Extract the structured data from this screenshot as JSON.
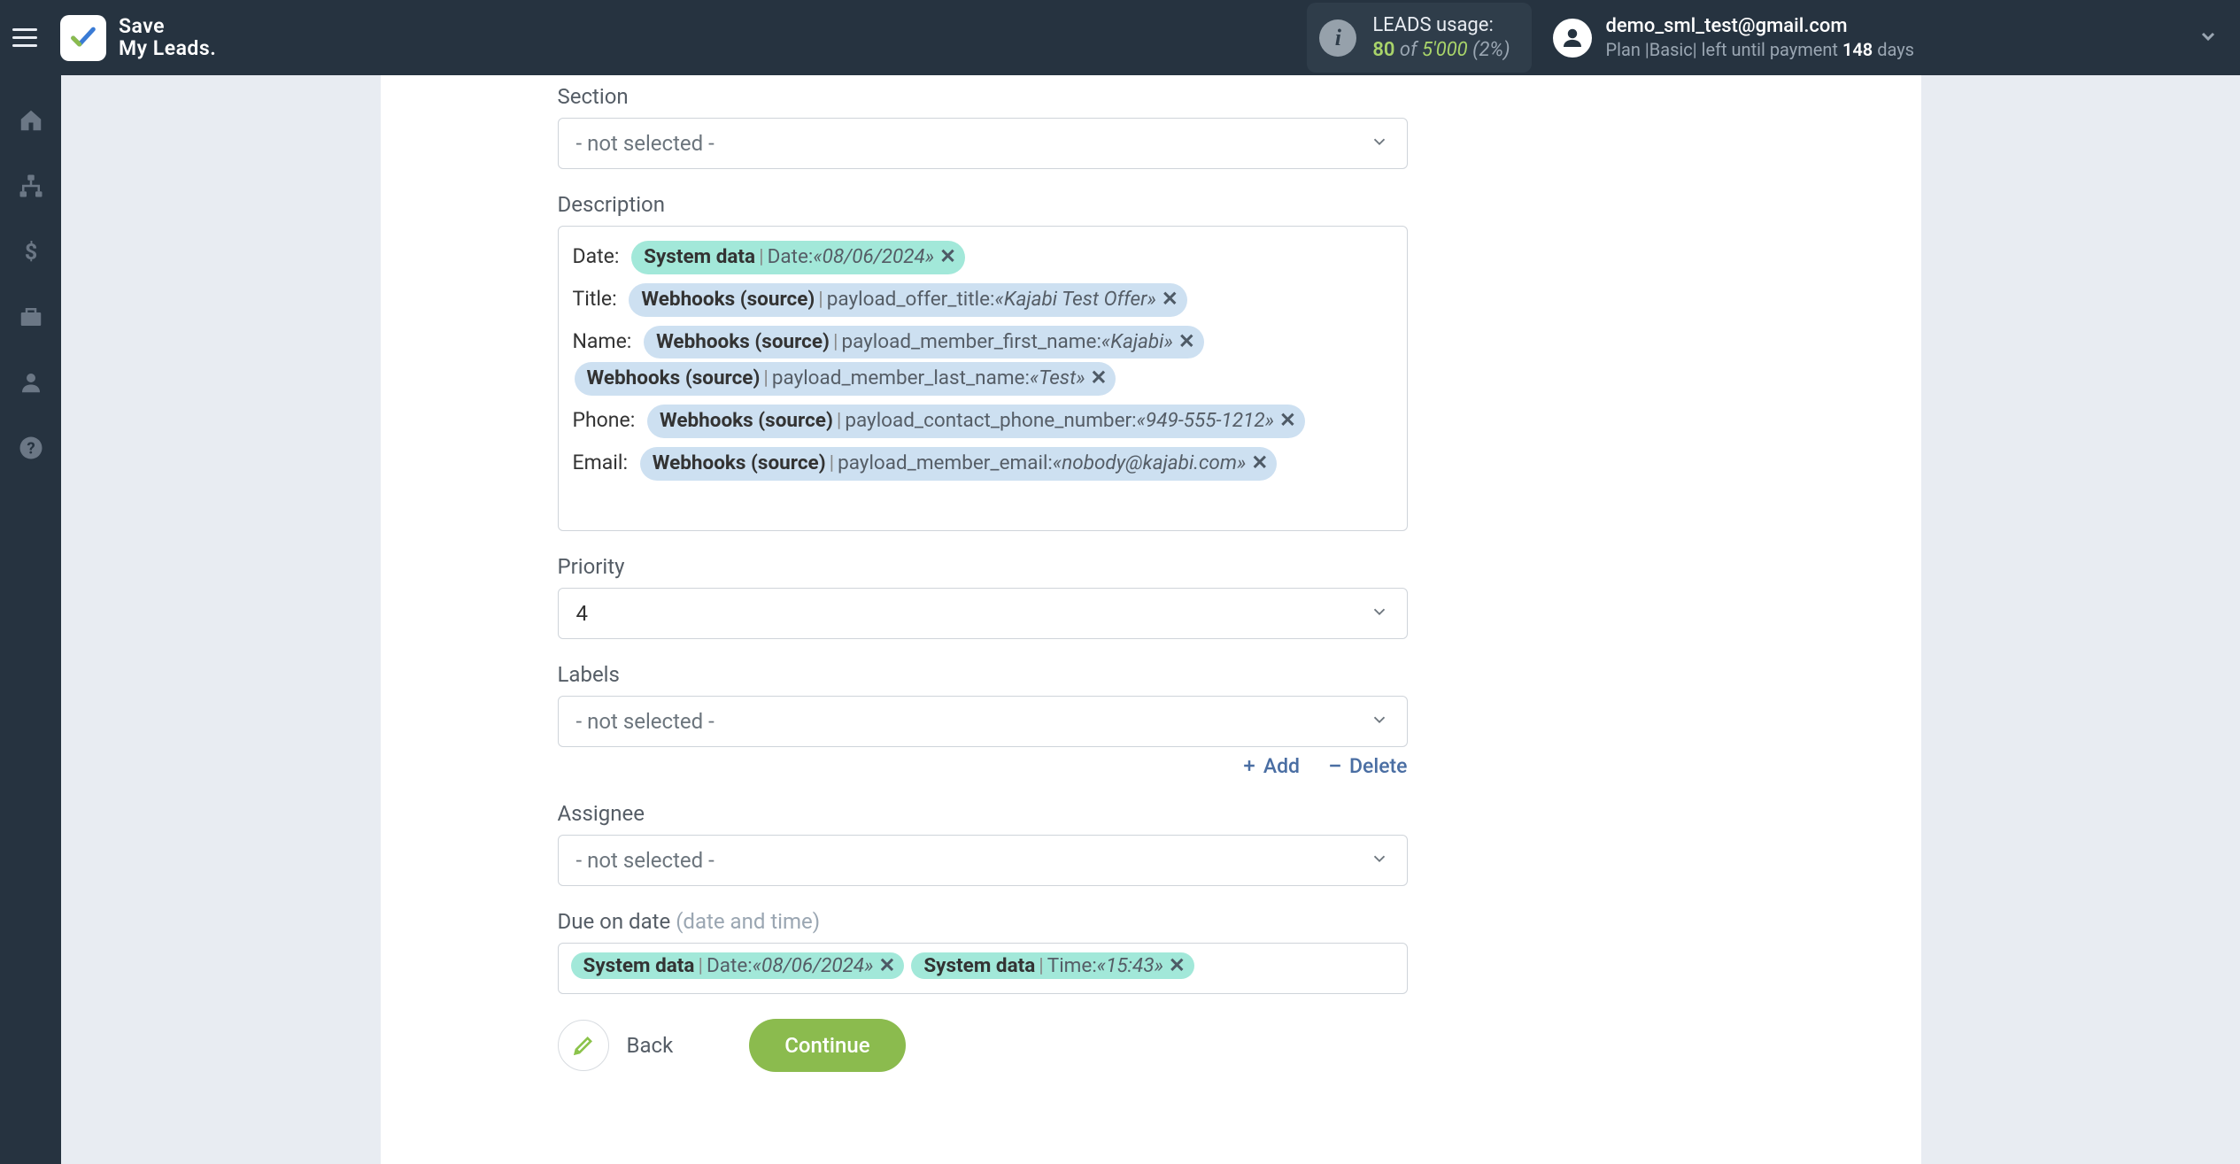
{
  "brand": {
    "line1": "Save",
    "line2": "My Leads."
  },
  "header": {
    "usage": {
      "title": "LEADS usage:",
      "used": "80",
      "of_word": "of",
      "total": "5'000",
      "pct": "(2%)"
    },
    "account": {
      "email": "demo_sml_test@gmail.com",
      "plan_prefix": "Plan |",
      "plan_name": "Basic",
      "plan_suffix": "| left until payment ",
      "days": "148",
      "days_word": " days"
    }
  },
  "form": {
    "section": {
      "label": "Section",
      "value": "- not selected -"
    },
    "description": {
      "label": "Description",
      "rows": {
        "date": {
          "label": "Date:",
          "tags": [
            {
              "kind": "system",
              "source": "System data",
              "field": "Date:",
              "value": "«08/06/2024»"
            }
          ]
        },
        "title": {
          "label": "Title:",
          "tags": [
            {
              "kind": "webhook",
              "source": "Webhooks (source)",
              "field": "payload_offer_title:",
              "value": "«Kajabi Test Offer»"
            }
          ]
        },
        "name": {
          "label": "Name:",
          "tags": [
            {
              "kind": "webhook",
              "source": "Webhooks (source)",
              "field": "payload_member_first_name:",
              "value": "«Kajabi»"
            },
            {
              "kind": "webhook",
              "source": "Webhooks (source)",
              "field": "payload_member_last_name:",
              "value": "«Test»"
            }
          ]
        },
        "phone": {
          "label": "Phone:",
          "tags": [
            {
              "kind": "webhook",
              "source": "Webhooks (source)",
              "field": "payload_contact_phone_number:",
              "value": "«949-555-1212»"
            }
          ]
        },
        "email": {
          "label": "Email:",
          "tags": [
            {
              "kind": "webhook",
              "source": "Webhooks (source)",
              "field": "payload_member_email:",
              "value": "«nobody@kajabi.com»"
            }
          ]
        }
      }
    },
    "priority": {
      "label": "Priority",
      "value": "4"
    },
    "labels": {
      "label": "Labels",
      "value": "- not selected -",
      "add": "Add",
      "delete": "Delete"
    },
    "assignee": {
      "label": "Assignee",
      "value": "- not selected -"
    },
    "due": {
      "label": "Due on date ",
      "hint": "(date and time)",
      "tags": [
        {
          "kind": "system",
          "source": "System data",
          "field": "Date:",
          "value": "«08/06/2024»"
        },
        {
          "kind": "system",
          "source": "System data",
          "field": "Time:",
          "value": "«15:43»"
        }
      ]
    },
    "buttons": {
      "back": "Back",
      "continue": "Continue"
    }
  }
}
